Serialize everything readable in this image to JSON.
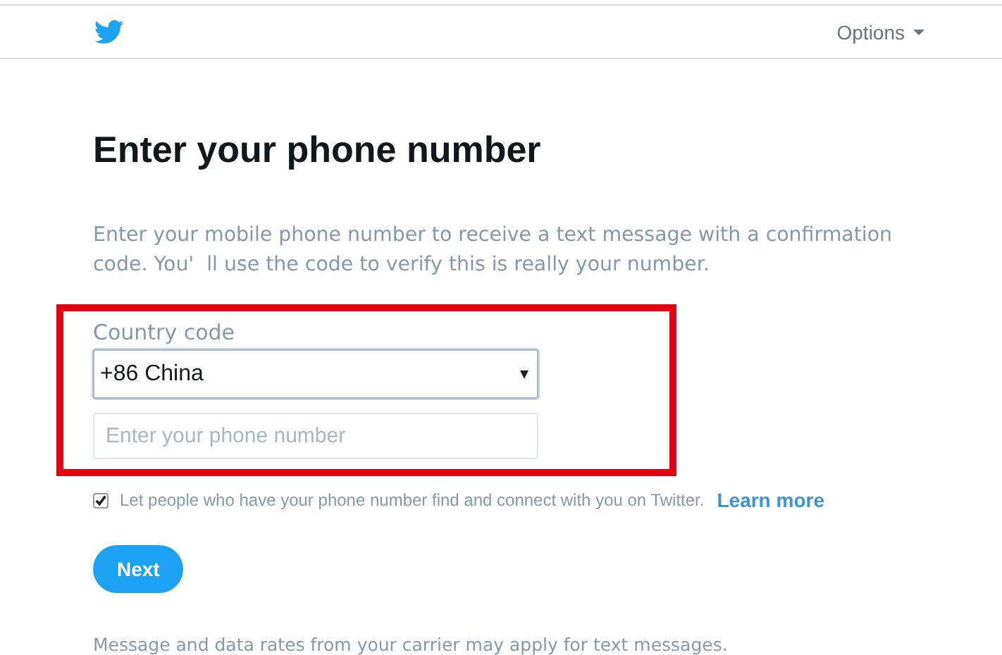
{
  "header": {
    "options_label": "Options"
  },
  "title": "Enter your phone number",
  "description": "Enter your mobile phone number to receive a text message with a confirmation code. You'  ll use the code to verify this is really your number.",
  "country_code": {
    "label": "Country code",
    "value": "+86 China"
  },
  "phone": {
    "placeholder": "Enter your phone number"
  },
  "discoverable": {
    "checked": true,
    "label": "Let people who have your phone number find and connect with you on Twitter.",
    "link": "Learn more"
  },
  "buttons": [
    "Next"
  ],
  "footnote": "Message and data rates from your carrier may apply for text messages."
}
